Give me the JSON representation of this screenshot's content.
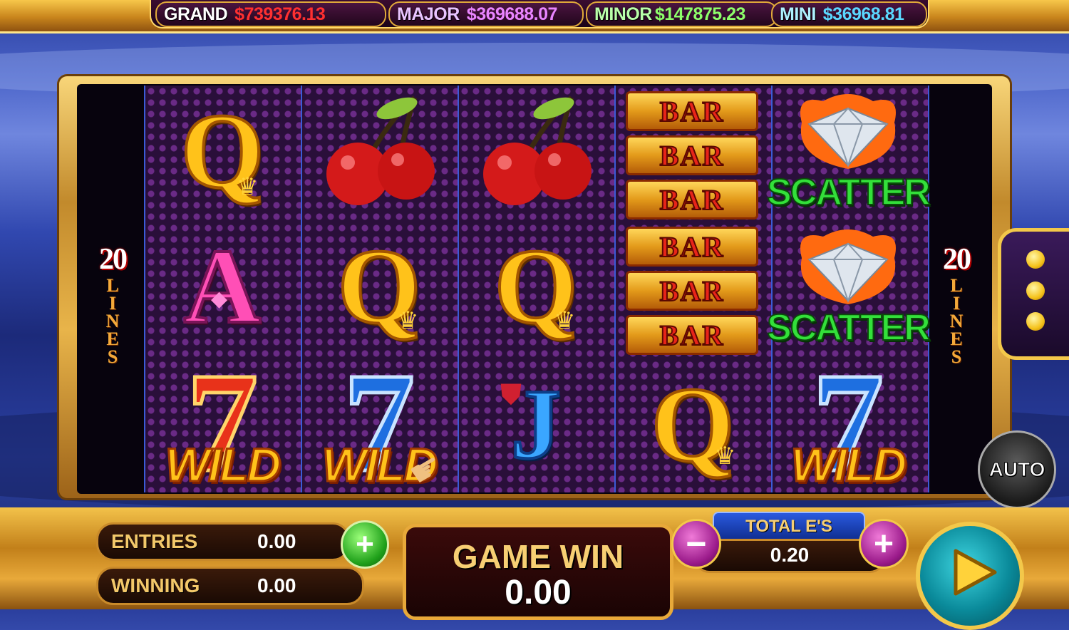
{
  "jackpots": [
    {
      "label": "GRAND",
      "value": "$739376.13",
      "color": "#ff3030"
    },
    {
      "label": "MAJOR",
      "value": "$369688.07",
      "color": "#e985ff"
    },
    {
      "label": "MINOR",
      "value": "$147875.23",
      "color": "#8dff6a"
    },
    {
      "label": "MINI",
      "value": "$36968.81",
      "color": "#5ad8ff"
    }
  ],
  "lines": {
    "count": "20",
    "text": "LINES"
  },
  "reels": [
    [
      "Q",
      "A",
      "WILD"
    ],
    [
      "cherry",
      "Q",
      "WILD"
    ],
    [
      "cherry",
      "Q",
      "J"
    ],
    [
      "BAR",
      "BAR",
      "Q"
    ],
    [
      "SCATTER",
      "SCATTER",
      "WILD"
    ]
  ],
  "symbols": {
    "bar": "BAR",
    "scatter": "SCATTER",
    "wild": "WILD"
  },
  "side_menu": {
    "icon": "vertical-dots-icon"
  },
  "auto_button": "AUTO",
  "entries": {
    "label": "ENTRIES",
    "value": "0.00"
  },
  "winning": {
    "label": "WINNING",
    "value": "0.00"
  },
  "game_win": {
    "label": "GAME WIN",
    "value": "0.00"
  },
  "total_bet": {
    "label": "TOTAL E'S",
    "value": "0.20"
  },
  "spin_icon": "play-icon"
}
